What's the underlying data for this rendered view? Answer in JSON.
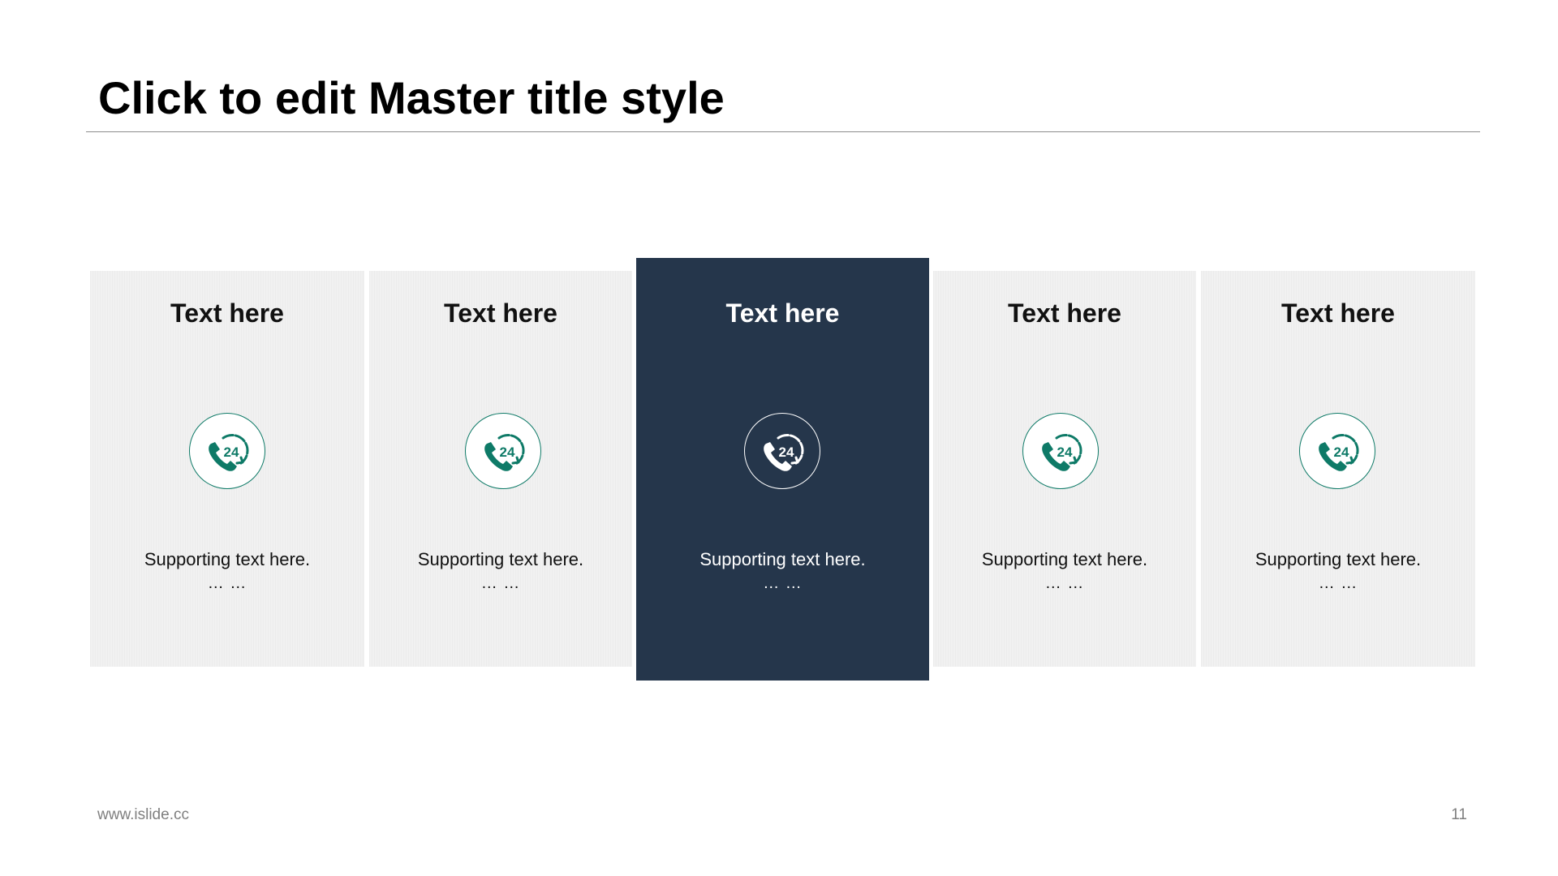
{
  "slide": {
    "title": "Click to edit Master title style",
    "footer_url": "www.islide.cc",
    "page_number": "11"
  },
  "colors": {
    "accent": "#0e7a67",
    "active_card": "#25364b",
    "card": "#f1f1f1"
  },
  "cards": [
    {
      "title": "Text here",
      "icon": "phone-24-hours-icon",
      "support": "Supporting  text here.",
      "ellipsis": "… …",
      "active": false
    },
    {
      "title": "Text here",
      "icon": "phone-24-hours-icon",
      "support": "Supporting  text here.",
      "ellipsis": "… …",
      "active": false
    },
    {
      "title": "Text here",
      "icon": "phone-24-hours-icon",
      "support": "Supporting  text here.",
      "ellipsis": "… …",
      "active": true
    },
    {
      "title": "Text here",
      "icon": "phone-24-hours-icon",
      "support": "Supporting  text here.",
      "ellipsis": "… …",
      "active": false
    },
    {
      "title": "Text here",
      "icon": "phone-24-hours-icon",
      "support": "Supporting  text here.",
      "ellipsis": "… …",
      "active": false
    }
  ]
}
